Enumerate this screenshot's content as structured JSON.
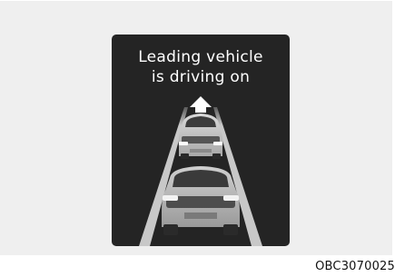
{
  "display": {
    "message_line1": "Leading vehicle",
    "message_line2": "is driving on"
  },
  "figure_code": "OBC3070025",
  "icons": {
    "arrow": "arrow-up-icon",
    "lead_vehicle": "leading-car-icon",
    "own_vehicle": "own-car-icon",
    "road": "road-lanes-icon"
  },
  "colors": {
    "screen_bg": "#242424",
    "panel_bg": "#efefef",
    "text": "#ffffff"
  }
}
